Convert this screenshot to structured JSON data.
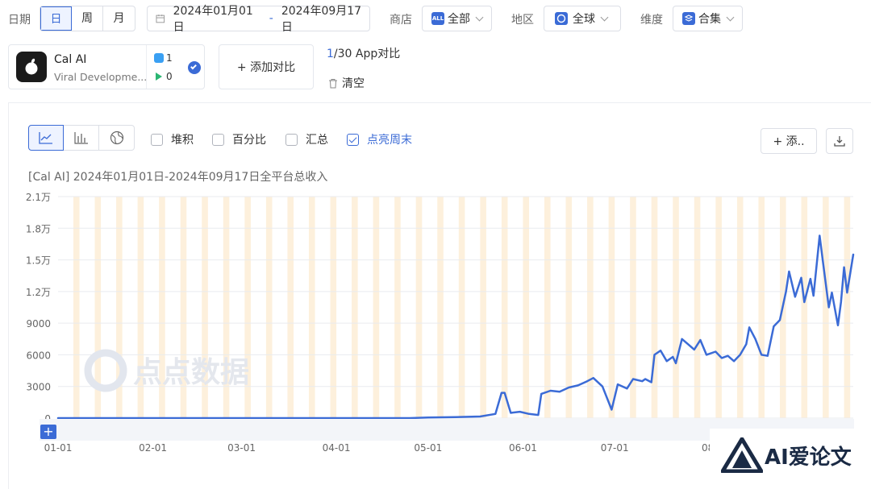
{
  "filters": {
    "date_label": "日期",
    "granularity": [
      "日",
      "周",
      "月"
    ],
    "granularity_selected": "日",
    "date_start": "2024年01月01日",
    "date_sep": "-",
    "date_end": "2024年09月17日",
    "store_label": "商店",
    "store_value": "全部",
    "store_badge": "ALL",
    "region_label": "地区",
    "region_value": "全球",
    "dimension_label": "维度",
    "dimension_value": "合集"
  },
  "app": {
    "name": "Cal AI",
    "developer": "Viral Developme...",
    "ios_count": "1",
    "android_count": "0"
  },
  "compare": {
    "add_label": "+ 添加对比",
    "count_current": "1",
    "count_rest": "/30 App对比",
    "clear_label": "清空"
  },
  "toolbar": {
    "stack_label": "堆积",
    "percent_label": "百分比",
    "sum_label": "汇总",
    "weekend_label": "点亮周末",
    "add_label": "+ 添..",
    "colors": {
      "accent": "#3b6bd6",
      "weekend": "#fdf0dc"
    }
  },
  "watermark": "点点数据",
  "corner_logo": "AI爱论文",
  "chart_data": {
    "type": "line",
    "title": "[Cal AI]  2024年01月01日-2024年09月17日全平台总收入",
    "x_range": [
      "2024-01-01",
      "2024-09-17"
    ],
    "x_ticks": [
      "01-01",
      "02-01",
      "03-01",
      "04-01",
      "05-01",
      "06-01",
      "07-01",
      "08-"
    ],
    "y_ticks": [
      "0",
      "3000",
      "6000",
      "9000",
      "1.2万",
      "1.5万",
      "1.8万",
      "2.1万"
    ],
    "ylim": [
      0,
      21000
    ],
    "weekend_highlight": true,
    "series": [
      {
        "color": "#3b6bd6",
        "points": [
          [
            "2024-01-01",
            0
          ],
          [
            "2024-04-25",
            0
          ],
          [
            "2024-05-01",
            50
          ],
          [
            "2024-05-10",
            100
          ],
          [
            "2024-05-18",
            150
          ],
          [
            "2024-05-23",
            400
          ],
          [
            "2024-05-25",
            2400
          ],
          [
            "2024-05-26",
            2400
          ],
          [
            "2024-05-28",
            500
          ],
          [
            "2024-05-31",
            600
          ],
          [
            "2024-06-03",
            400
          ],
          [
            "2024-06-06",
            300
          ],
          [
            "2024-06-07",
            2300
          ],
          [
            "2024-06-10",
            2600
          ],
          [
            "2024-06-13",
            2500
          ],
          [
            "2024-06-16",
            2900
          ],
          [
            "2024-06-19",
            3100
          ],
          [
            "2024-06-22",
            3500
          ],
          [
            "2024-06-24",
            3800
          ],
          [
            "2024-06-27",
            3000
          ],
          [
            "2024-06-30",
            800
          ],
          [
            "2024-07-02",
            3200
          ],
          [
            "2024-07-05",
            2800
          ],
          [
            "2024-07-07",
            3700
          ],
          [
            "2024-07-10",
            3500
          ],
          [
            "2024-07-11",
            3700
          ],
          [
            "2024-07-13",
            3400
          ],
          [
            "2024-07-14",
            6000
          ],
          [
            "2024-07-16",
            6400
          ],
          [
            "2024-07-18",
            5400
          ],
          [
            "2024-07-20",
            5800
          ],
          [
            "2024-07-21",
            5200
          ],
          [
            "2024-07-23",
            7500
          ],
          [
            "2024-07-25",
            7000
          ],
          [
            "2024-07-27",
            6500
          ],
          [
            "2024-07-29",
            7400
          ],
          [
            "2024-07-31",
            6000
          ],
          [
            "2024-08-03",
            6300
          ],
          [
            "2024-08-05",
            5700
          ],
          [
            "2024-08-07",
            5900
          ],
          [
            "2024-08-09",
            5400
          ],
          [
            "2024-08-11",
            6000
          ],
          [
            "2024-08-13",
            7000
          ],
          [
            "2024-08-14",
            8600
          ],
          [
            "2024-08-16",
            7500
          ],
          [
            "2024-08-18",
            6000
          ],
          [
            "2024-08-20",
            5900
          ],
          [
            "2024-08-22",
            8700
          ],
          [
            "2024-08-24",
            9300
          ],
          [
            "2024-08-26",
            12000
          ],
          [
            "2024-08-27",
            13900
          ],
          [
            "2024-08-29",
            11500
          ],
          [
            "2024-08-31",
            13300
          ],
          [
            "2024-09-01",
            11000
          ],
          [
            "2024-09-03",
            13200
          ],
          [
            "2024-09-04",
            11600
          ],
          [
            "2024-09-06",
            17300
          ],
          [
            "2024-09-07",
            15000
          ],
          [
            "2024-09-09",
            10500
          ],
          [
            "2024-09-10",
            11900
          ],
          [
            "2024-09-12",
            8800
          ],
          [
            "2024-09-13",
            11000
          ],
          [
            "2024-09-14",
            14300
          ],
          [
            "2024-09-15",
            11900
          ],
          [
            "2024-09-17",
            15500
          ]
        ]
      }
    ]
  }
}
